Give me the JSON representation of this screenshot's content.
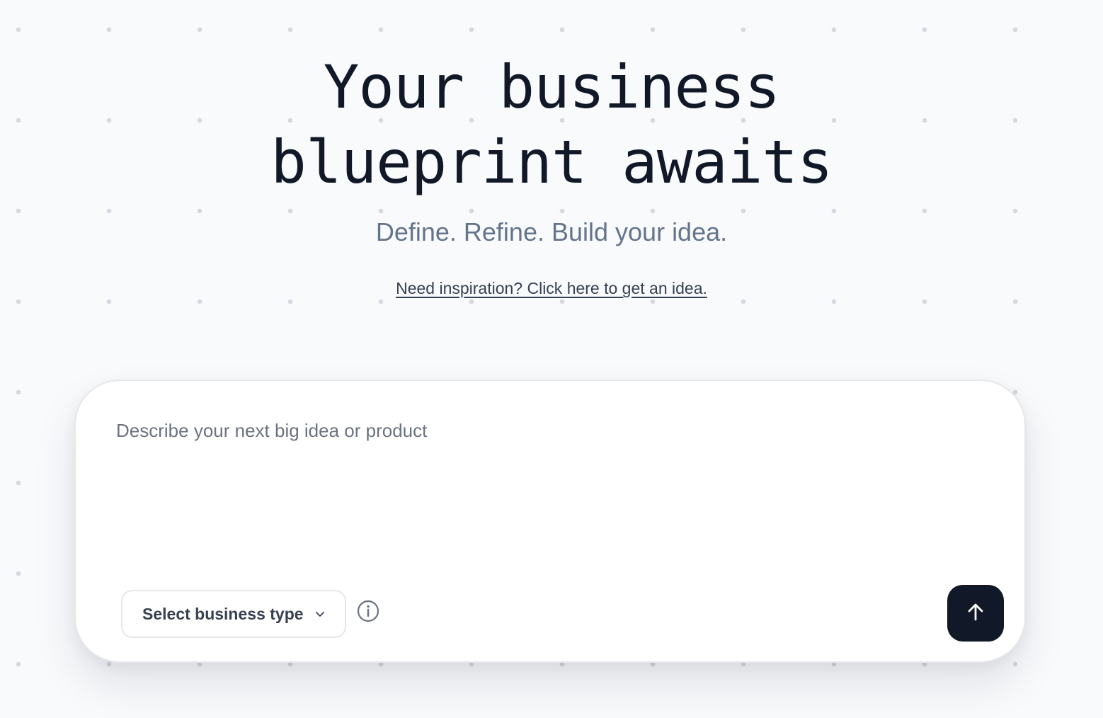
{
  "hero": {
    "title_line1": "Your business",
    "title_line2": "blueprint awaits",
    "subtitle": "Define. Refine. Build your idea.",
    "inspiration_link": "Need inspiration? Click here to get an idea."
  },
  "prompt": {
    "value": "",
    "placeholder": "Describe your next big idea or product"
  },
  "business_type": {
    "selected_label": "Select business type",
    "icon": "chevron-down-icon"
  },
  "info": {
    "icon": "info-icon"
  },
  "submit": {
    "icon": "arrow-up-icon"
  },
  "colors": {
    "background": "#f8fafc",
    "dots": "#d5dae1",
    "title": "#111827",
    "subtitle": "#64748b",
    "link": "#374151",
    "placeholder": "#6b7280",
    "card_border": "#e5e7eb",
    "send_button": "#111827",
    "send_icon": "#ffffff"
  }
}
